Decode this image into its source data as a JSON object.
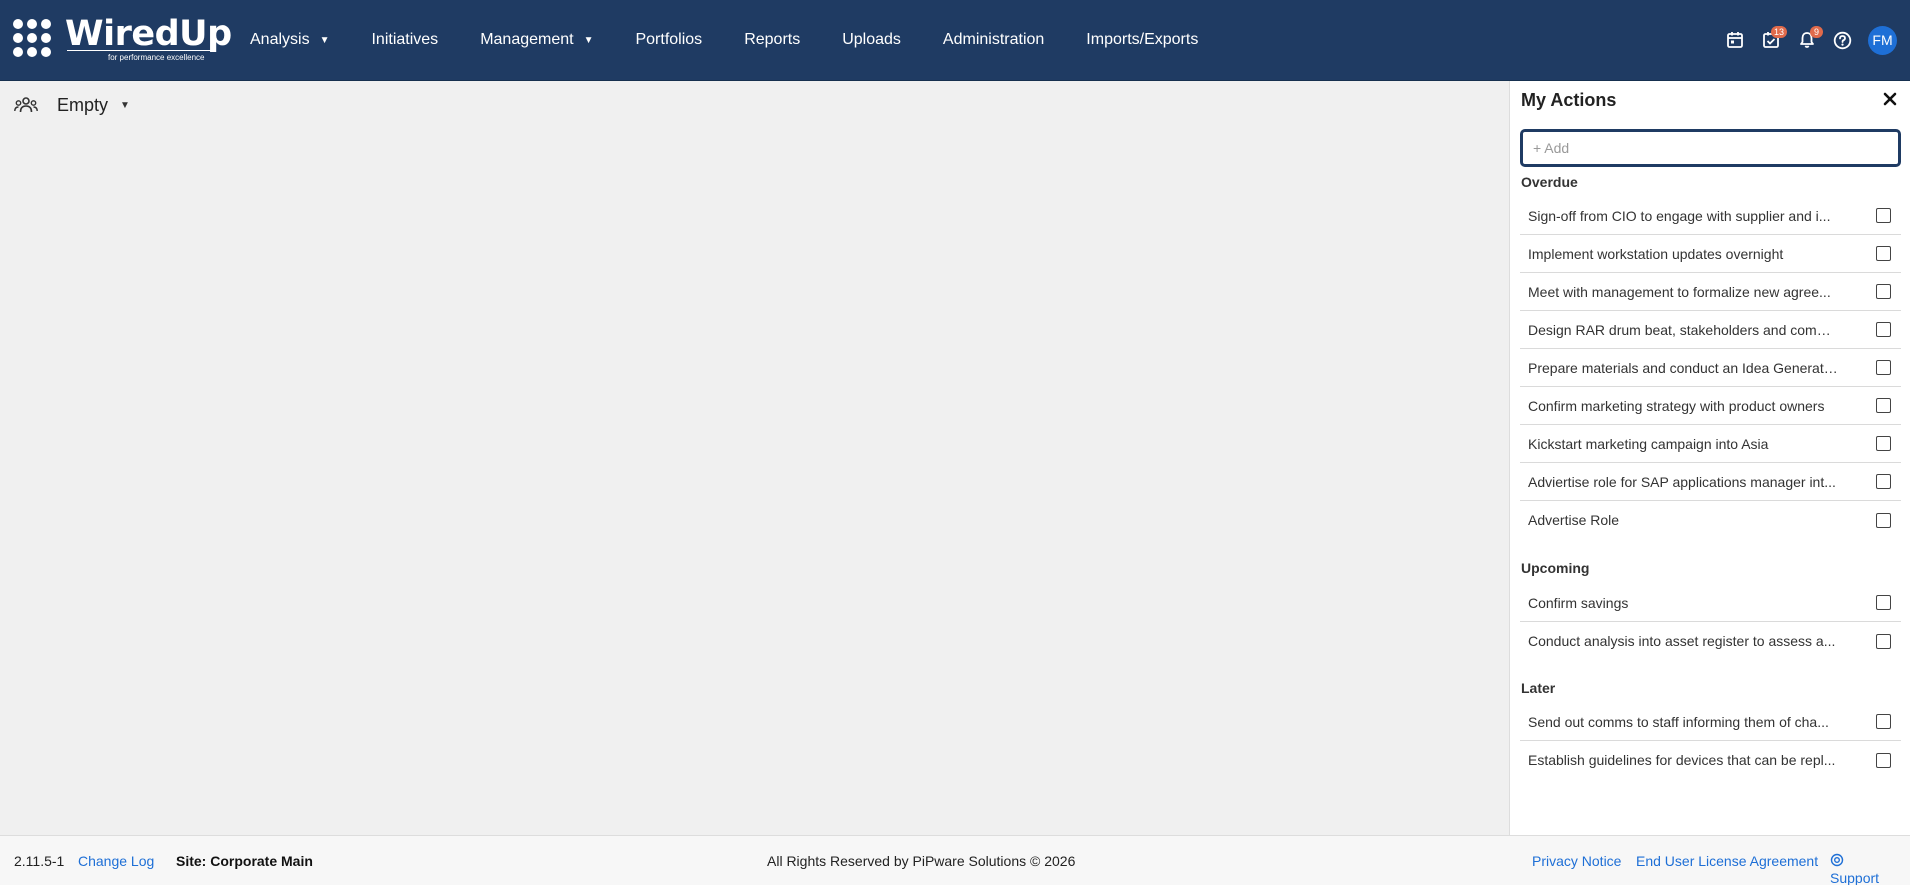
{
  "app": {
    "logo_text": "WiredUp",
    "logo_tagline": "for performance excellence"
  },
  "nav": {
    "items": [
      {
        "label": "Analysis",
        "has_dropdown": true
      },
      {
        "label": "Initiatives",
        "has_dropdown": false
      },
      {
        "label": "Management",
        "has_dropdown": true
      },
      {
        "label": "Portfolios",
        "has_dropdown": false
      },
      {
        "label": "Reports",
        "has_dropdown": false
      },
      {
        "label": "Uploads",
        "has_dropdown": false
      },
      {
        "label": "Administration",
        "has_dropdown": false
      },
      {
        "label": "Imports/Exports",
        "has_dropdown": false
      }
    ]
  },
  "toolbar": {
    "calendar_icon": "calendar-icon",
    "actions_icon": "task-check-icon",
    "actions_badge": "13",
    "notifications_icon": "bell-icon",
    "notifications_badge": "9",
    "help_icon": "help-icon",
    "avatar_initials": "FM"
  },
  "subheader": {
    "group_icon": "group-icon",
    "selector_label": "Empty"
  },
  "panel": {
    "title": "My Actions",
    "add_placeholder": "+ Add",
    "sections": [
      {
        "title": "Overdue",
        "items": [
          "Sign-off from CIO to engage with supplier and i...",
          "Implement workstation updates overnight",
          "Meet with management to formalize new agree...",
          "Design RAR drum beat, stakeholders and comm...",
          "Prepare materials and conduct an Idea Generati...",
          "Confirm marketing strategy with product owners",
          "Kickstart marketing campaign into Asia",
          "Adviertise role for SAP applications manager int...",
          "Advertise Role"
        ]
      },
      {
        "title": "Upcoming",
        "items": [
          "Confirm savings",
          "Conduct analysis into asset register to assess a..."
        ]
      },
      {
        "title": "Later",
        "items": [
          "Send out comms to staff informing them of cha...",
          "Establish guidelines for devices that can be repl..."
        ]
      }
    ]
  },
  "footer": {
    "version": "2.11.5-1",
    "change_log": "Change Log",
    "site": "Site: Corporate Main",
    "rights": "All Rights Reserved by PiPware Solutions © 2026",
    "privacy": "Privacy Notice",
    "eula": "End User License Agreement",
    "support": "Support"
  },
  "colors": {
    "header_bg": "#1f3b63",
    "badge": "#e06a4b",
    "avatar": "#1e6fd6",
    "link": "#1e6fd6"
  }
}
